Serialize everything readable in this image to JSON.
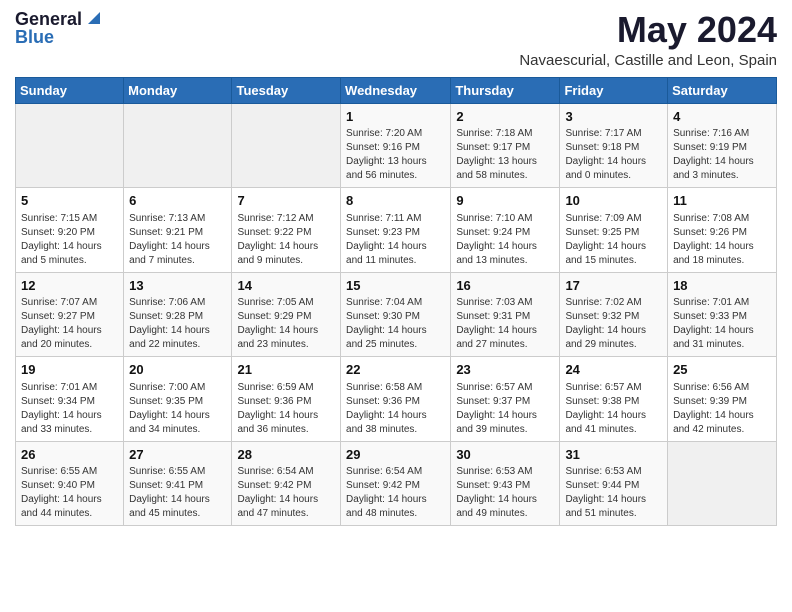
{
  "logo": {
    "general": "General",
    "blue": "Blue"
  },
  "title": "May 2024",
  "subtitle": "Navaescurial, Castille and Leon, Spain",
  "days_of_week": [
    "Sunday",
    "Monday",
    "Tuesday",
    "Wednesday",
    "Thursday",
    "Friday",
    "Saturday"
  ],
  "weeks": [
    [
      {
        "day": "",
        "sunrise": "",
        "sunset": "",
        "daylight": "",
        "empty": true
      },
      {
        "day": "",
        "sunrise": "",
        "sunset": "",
        "daylight": "",
        "empty": true
      },
      {
        "day": "",
        "sunrise": "",
        "sunset": "",
        "daylight": "",
        "empty": true
      },
      {
        "day": "1",
        "sunrise": "Sunrise: 7:20 AM",
        "sunset": "Sunset: 9:16 PM",
        "daylight": "Daylight: 13 hours and 56 minutes."
      },
      {
        "day": "2",
        "sunrise": "Sunrise: 7:18 AM",
        "sunset": "Sunset: 9:17 PM",
        "daylight": "Daylight: 13 hours and 58 minutes."
      },
      {
        "day": "3",
        "sunrise": "Sunrise: 7:17 AM",
        "sunset": "Sunset: 9:18 PM",
        "daylight": "Daylight: 14 hours and 0 minutes."
      },
      {
        "day": "4",
        "sunrise": "Sunrise: 7:16 AM",
        "sunset": "Sunset: 9:19 PM",
        "daylight": "Daylight: 14 hours and 3 minutes."
      }
    ],
    [
      {
        "day": "5",
        "sunrise": "Sunrise: 7:15 AM",
        "sunset": "Sunset: 9:20 PM",
        "daylight": "Daylight: 14 hours and 5 minutes."
      },
      {
        "day": "6",
        "sunrise": "Sunrise: 7:13 AM",
        "sunset": "Sunset: 9:21 PM",
        "daylight": "Daylight: 14 hours and 7 minutes."
      },
      {
        "day": "7",
        "sunrise": "Sunrise: 7:12 AM",
        "sunset": "Sunset: 9:22 PM",
        "daylight": "Daylight: 14 hours and 9 minutes."
      },
      {
        "day": "8",
        "sunrise": "Sunrise: 7:11 AM",
        "sunset": "Sunset: 9:23 PM",
        "daylight": "Daylight: 14 hours and 11 minutes."
      },
      {
        "day": "9",
        "sunrise": "Sunrise: 7:10 AM",
        "sunset": "Sunset: 9:24 PM",
        "daylight": "Daylight: 14 hours and 13 minutes."
      },
      {
        "day": "10",
        "sunrise": "Sunrise: 7:09 AM",
        "sunset": "Sunset: 9:25 PM",
        "daylight": "Daylight: 14 hours and 15 minutes."
      },
      {
        "day": "11",
        "sunrise": "Sunrise: 7:08 AM",
        "sunset": "Sunset: 9:26 PM",
        "daylight": "Daylight: 14 hours and 18 minutes."
      }
    ],
    [
      {
        "day": "12",
        "sunrise": "Sunrise: 7:07 AM",
        "sunset": "Sunset: 9:27 PM",
        "daylight": "Daylight: 14 hours and 20 minutes."
      },
      {
        "day": "13",
        "sunrise": "Sunrise: 7:06 AM",
        "sunset": "Sunset: 9:28 PM",
        "daylight": "Daylight: 14 hours and 22 minutes."
      },
      {
        "day": "14",
        "sunrise": "Sunrise: 7:05 AM",
        "sunset": "Sunset: 9:29 PM",
        "daylight": "Daylight: 14 hours and 23 minutes."
      },
      {
        "day": "15",
        "sunrise": "Sunrise: 7:04 AM",
        "sunset": "Sunset: 9:30 PM",
        "daylight": "Daylight: 14 hours and 25 minutes."
      },
      {
        "day": "16",
        "sunrise": "Sunrise: 7:03 AM",
        "sunset": "Sunset: 9:31 PM",
        "daylight": "Daylight: 14 hours and 27 minutes."
      },
      {
        "day": "17",
        "sunrise": "Sunrise: 7:02 AM",
        "sunset": "Sunset: 9:32 PM",
        "daylight": "Daylight: 14 hours and 29 minutes."
      },
      {
        "day": "18",
        "sunrise": "Sunrise: 7:01 AM",
        "sunset": "Sunset: 9:33 PM",
        "daylight": "Daylight: 14 hours and 31 minutes."
      }
    ],
    [
      {
        "day": "19",
        "sunrise": "Sunrise: 7:01 AM",
        "sunset": "Sunset: 9:34 PM",
        "daylight": "Daylight: 14 hours and 33 minutes."
      },
      {
        "day": "20",
        "sunrise": "Sunrise: 7:00 AM",
        "sunset": "Sunset: 9:35 PM",
        "daylight": "Daylight: 14 hours and 34 minutes."
      },
      {
        "day": "21",
        "sunrise": "Sunrise: 6:59 AM",
        "sunset": "Sunset: 9:36 PM",
        "daylight": "Daylight: 14 hours and 36 minutes."
      },
      {
        "day": "22",
        "sunrise": "Sunrise: 6:58 AM",
        "sunset": "Sunset: 9:36 PM",
        "daylight": "Daylight: 14 hours and 38 minutes."
      },
      {
        "day": "23",
        "sunrise": "Sunrise: 6:57 AM",
        "sunset": "Sunset: 9:37 PM",
        "daylight": "Daylight: 14 hours and 39 minutes."
      },
      {
        "day": "24",
        "sunrise": "Sunrise: 6:57 AM",
        "sunset": "Sunset: 9:38 PM",
        "daylight": "Daylight: 14 hours and 41 minutes."
      },
      {
        "day": "25",
        "sunrise": "Sunrise: 6:56 AM",
        "sunset": "Sunset: 9:39 PM",
        "daylight": "Daylight: 14 hours and 42 minutes."
      }
    ],
    [
      {
        "day": "26",
        "sunrise": "Sunrise: 6:55 AM",
        "sunset": "Sunset: 9:40 PM",
        "daylight": "Daylight: 14 hours and 44 minutes."
      },
      {
        "day": "27",
        "sunrise": "Sunrise: 6:55 AM",
        "sunset": "Sunset: 9:41 PM",
        "daylight": "Daylight: 14 hours and 45 minutes."
      },
      {
        "day": "28",
        "sunrise": "Sunrise: 6:54 AM",
        "sunset": "Sunset: 9:42 PM",
        "daylight": "Daylight: 14 hours and 47 minutes."
      },
      {
        "day": "29",
        "sunrise": "Sunrise: 6:54 AM",
        "sunset": "Sunset: 9:42 PM",
        "daylight": "Daylight: 14 hours and 48 minutes."
      },
      {
        "day": "30",
        "sunrise": "Sunrise: 6:53 AM",
        "sunset": "Sunset: 9:43 PM",
        "daylight": "Daylight: 14 hours and 49 minutes."
      },
      {
        "day": "31",
        "sunrise": "Sunrise: 6:53 AM",
        "sunset": "Sunset: 9:44 PM",
        "daylight": "Daylight: 14 hours and 51 minutes."
      },
      {
        "day": "",
        "sunrise": "",
        "sunset": "",
        "daylight": "",
        "empty": true
      }
    ]
  ]
}
